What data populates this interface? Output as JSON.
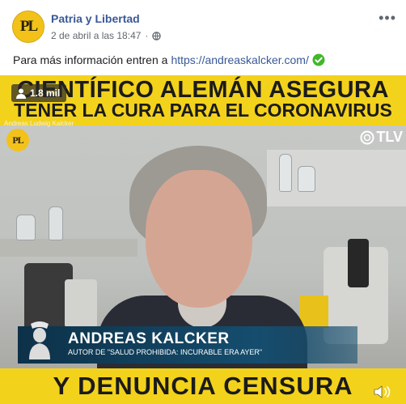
{
  "page": {
    "avatar_text": "PL",
    "name": "Patria y Libertad",
    "timestamp": "2 de abril a las 18:47",
    "audience_icon": "globe-icon",
    "more_icon": "ellipsis-icon",
    "more_label": "•••"
  },
  "post": {
    "text": "Para más información entren a",
    "link": "https://andreaskalcker.com/",
    "check_icon": "check-circle-icon",
    "check_color": "#42b72a"
  },
  "video": {
    "views": "1.8 mil",
    "views_icon": "person-icon",
    "headline_line1": "CIENTÍFICO ALEMÁN ASEGURA",
    "headline_line2": "TENER LA CURA PARA EL CORONAVIRUS",
    "watermark_name": "Andreas Ludwig Kalcker",
    "mini_logo_text": "PL",
    "channel_logo": "TLV",
    "lower_third_name": "ANDREAS KALCKER",
    "lower_third_role": "AUTOR DE \"SALUD PROHIBIDA: INCURABLE ERA AYER\"",
    "bottom_banner": "Y DENUNCIA CENSURA",
    "volume_icon": "volume-icon",
    "banner_color": "#f3d21c"
  }
}
